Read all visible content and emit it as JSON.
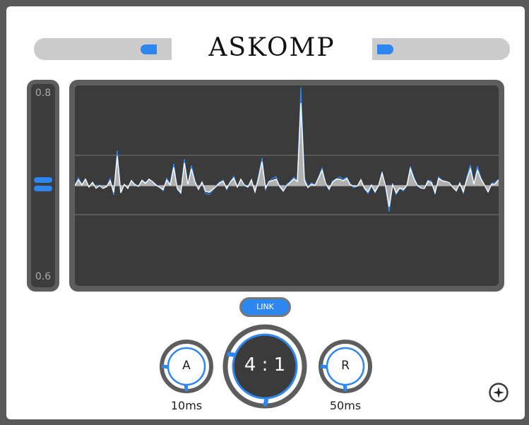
{
  "header": {
    "title": "ASKOMP",
    "left_slider_value": 0.88,
    "right_slider_value": 0.04
  },
  "threshold_slider": {
    "max_label": "0.8",
    "min_label": "0.6",
    "value": 0.7
  },
  "link_button": {
    "label": "LINK"
  },
  "knobs": {
    "attack": {
      "letter": "A",
      "value_label": "10ms",
      "arc_fraction": 0.25
    },
    "ratio": {
      "label": "4 : 1",
      "arc_fraction": 0.3
    },
    "release": {
      "letter": "R",
      "value_label": "50ms",
      "arc_fraction": 0.25
    }
  },
  "colors": {
    "accent": "#2e86f0",
    "panel": "#ffffff",
    "frame": "#5d5d5d",
    "screen": "#3b3b3b",
    "slider_track": "#cbcbcb"
  },
  "icons": {
    "settings": "sun-icon"
  }
}
